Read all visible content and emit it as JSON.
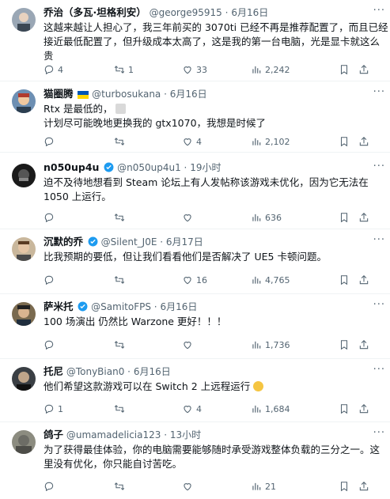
{
  "tweets": [
    {
      "name": "乔治（多瓦·坦格利安）",
      "handle": "@george95915",
      "date": "6月16日",
      "lines": [
        "这越来越让人担心了，我三年前买的 3070ti 已经不再是推荐配置了，而且已经",
        "接近最低配置了，但升级成本太高了，这是我的第一台电脑，光是显卡就这么",
        "贵"
      ],
      "reply": "4",
      "retweet": "1",
      "like": "33",
      "views": "2,242"
    },
    {
      "name": "猫圈腾",
      "handle": "@turbosukana",
      "date": "6月16日",
      "lines": [
        "Rtx 是最低的，",
        "计划尽可能晚地更换我的 gtx1070，我想是时候了"
      ],
      "reply": "",
      "retweet": "",
      "like": "4",
      "views": "2,102"
    },
    {
      "name": "n050up4u",
      "handle": "@n050up4u1",
      "date": "19小时",
      "lines": [
        "迫不及待地想看到 Steam 论坛上有人发帖称该游戏未优化，因为它无法在",
        "1050 上运行。"
      ],
      "reply": "",
      "retweet": "",
      "like": "",
      "views": "636"
    },
    {
      "name": "沉默的乔",
      "handle": "@Silent_J0E",
      "date": "6月17日",
      "lines": [
        "比我预期的要低，但让我们看看他们是否解决了 UE5 卡顿问题。"
      ],
      "reply": "",
      "retweet": "",
      "like": "16",
      "views": "4,765"
    },
    {
      "name": "萨米托",
      "handle": "@SamitoFPS",
      "date": "6月16日",
      "lines": [
        "100 场演出 仍然比 Warzone 更好！！！"
      ],
      "reply": "",
      "retweet": "",
      "like": "",
      "views": "1,736"
    },
    {
      "name": "托尼",
      "handle": "@TonyBian0",
      "date": "6月16日",
      "lines": [
        "他们希望这款游戏可以在 Switch 2 上远程运行"
      ],
      "reply": "1",
      "retweet": "",
      "like": "4",
      "views": "1,684"
    },
    {
      "name": "鸽子",
      "handle": "@umamadelicia123",
      "date": "13小时",
      "lines": [
        "为了获得最佳体验，你的电脑需要能够随时承受游戏整体负载的三分之一。这",
        "里没有优化，你只能自讨苦吃。"
      ],
      "reply": "",
      "retweet": "",
      "like": "",
      "views": "21"
    }
  ],
  "sep": "·",
  "colors": {
    "text": "#0f1419",
    "secondary": "#536471",
    "verified": "#1d9bf0"
  },
  "icons": [
    "reply-icon",
    "retweet-icon",
    "like-icon",
    "views-icon",
    "bookmark-icon",
    "share-icon",
    "more-icon",
    "verified-badge-icon"
  ]
}
